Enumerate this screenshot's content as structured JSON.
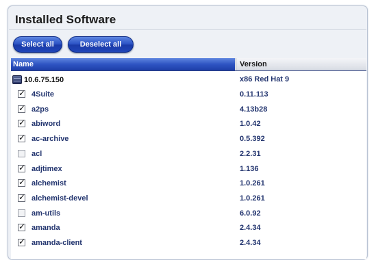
{
  "panel": {
    "title": "Installed Software"
  },
  "toolbar": {
    "select_all_label": "Select all",
    "deselect_all_label": "Deselect all"
  },
  "table": {
    "columns": {
      "name": "Name",
      "version": "Version"
    },
    "host": {
      "name": "10.6.75.150",
      "version": "x86 Red Hat 9",
      "icon": "server-icon"
    },
    "rows": [
      {
        "name": "4Suite",
        "version": "0.11.113",
        "checked": true
      },
      {
        "name": "a2ps",
        "version": "4.13b28",
        "checked": true
      },
      {
        "name": "abiword",
        "version": "1.0.42",
        "checked": true
      },
      {
        "name": "ac-archive",
        "version": "0.5.392",
        "checked": true
      },
      {
        "name": "acl",
        "version": "2.2.31",
        "checked": false
      },
      {
        "name": "adjtimex",
        "version": "1.136",
        "checked": true
      },
      {
        "name": "alchemist",
        "version": "1.0.261",
        "checked": true
      },
      {
        "name": "alchemist-devel",
        "version": "1.0.261",
        "checked": true
      },
      {
        "name": "am-utils",
        "version": "6.0.92",
        "checked": false
      },
      {
        "name": "amanda",
        "version": "2.4.34",
        "checked": true
      },
      {
        "name": "amanda-client",
        "version": "2.4.34",
        "checked": true
      }
    ]
  }
}
